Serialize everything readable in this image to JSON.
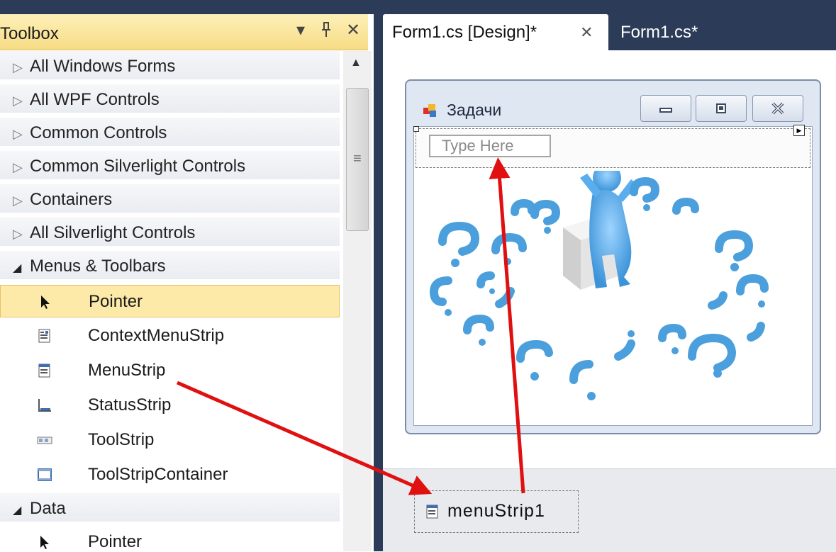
{
  "toolbox": {
    "title": "Toolbox",
    "dropdown_glyph": "▾",
    "pin_glyph": "ᵖ",
    "close_glyph": "✕",
    "categories_collapsed": [
      "All Windows Forms",
      "All WPF Controls",
      "Common Controls",
      "Common Silverlight Controls",
      "Containers",
      "All Silverlight Controls"
    ],
    "menus_category": "Menus & Toolbars",
    "menus_items": [
      {
        "label": "Pointer",
        "icon": "pointer-icon"
      },
      {
        "label": "ContextMenuStrip",
        "icon": "context-menu-strip-icon"
      },
      {
        "label": "MenuStrip",
        "icon": "menu-strip-icon"
      },
      {
        "label": "StatusStrip",
        "icon": "status-strip-icon"
      },
      {
        "label": "ToolStrip",
        "icon": "tool-strip-icon"
      },
      {
        "label": "ToolStripContainer",
        "icon": "tool-strip-container-icon"
      }
    ],
    "data_category": "Data",
    "data_items": [
      {
        "label": "Pointer",
        "icon": "pointer-icon"
      }
    ],
    "collapsed_arrow": "▷",
    "expanded_arrow": "◢"
  },
  "tabs": {
    "design": "Form1.cs [Design]*",
    "design_close": "✕",
    "code": "Form1.cs*"
  },
  "form": {
    "title": "Задачи",
    "min_glyph": "▭",
    "max_glyph": "▣",
    "close_glyph": "✕",
    "menu_placeholder": "Type Here"
  },
  "tray": {
    "component": "menuStrip1"
  },
  "colors": {
    "ide_dark": "#2b3b58",
    "toolbox_header": "#f7dc86",
    "selected_item": "#fde9a8",
    "arrow": "#e01010",
    "question_blue": "#4a9fdc"
  }
}
